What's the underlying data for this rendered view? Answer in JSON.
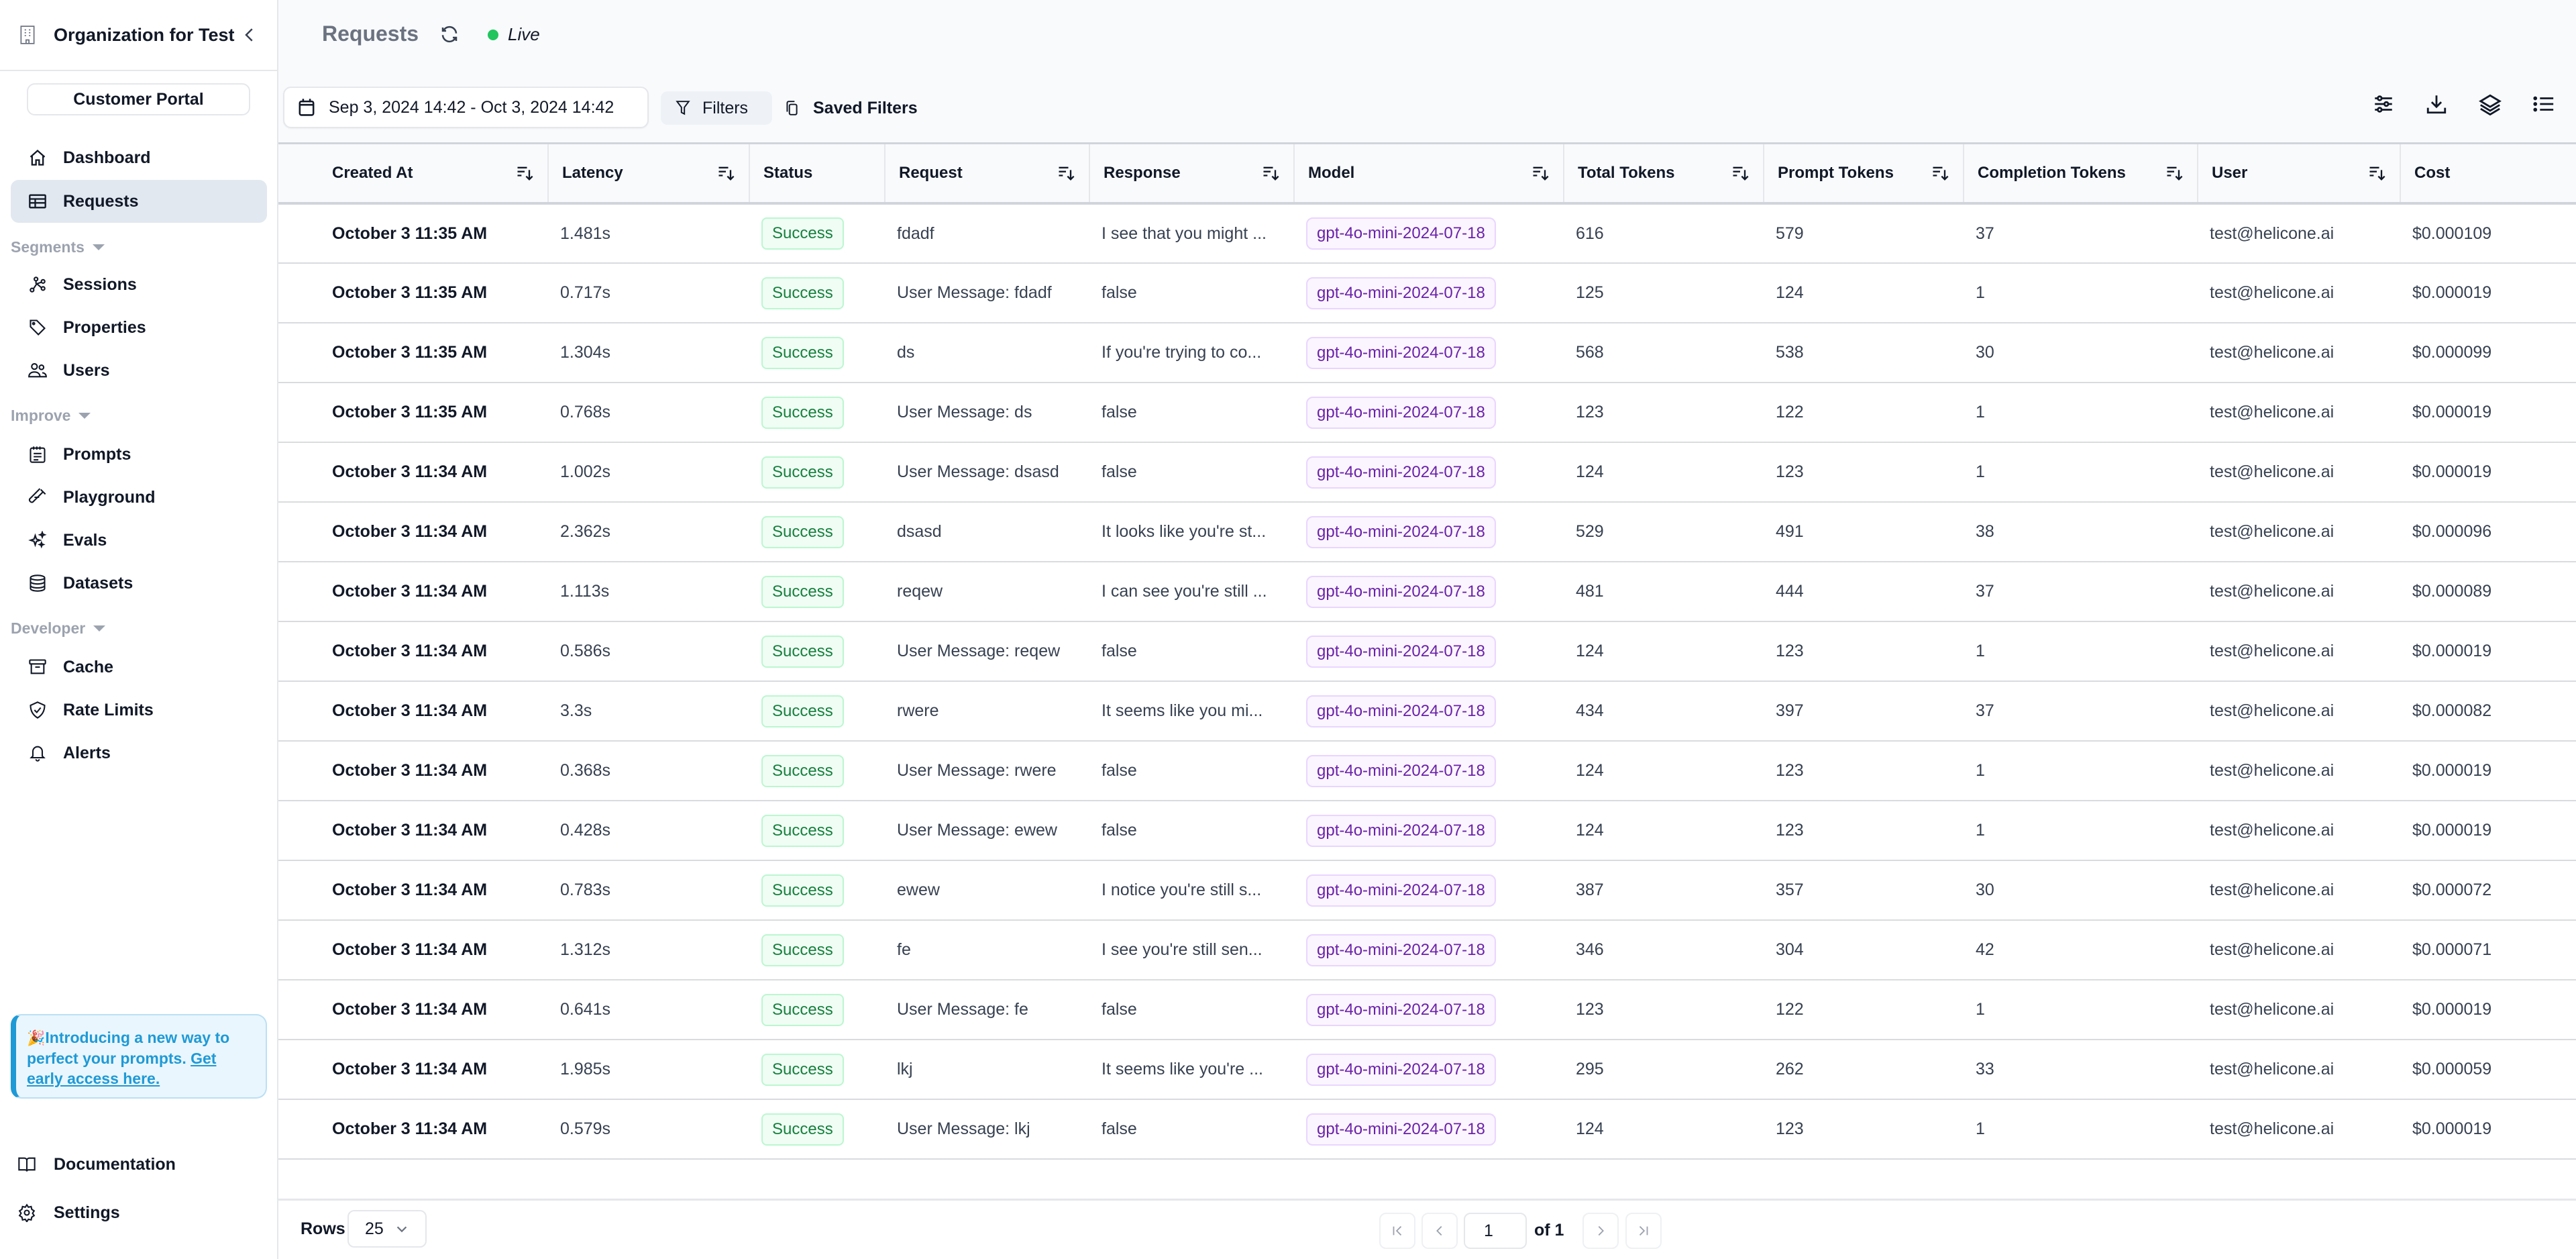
{
  "sidebar": {
    "org_name": "Organization for Test",
    "customer_portal": "Customer Portal",
    "top_items": [
      {
        "label": "Dashboard",
        "icon": "home-icon"
      },
      {
        "label": "Requests",
        "icon": "table-icon",
        "active": true
      }
    ],
    "sections": [
      {
        "label": "Segments",
        "items": [
          {
            "label": "Sessions",
            "icon": "sessions-icon"
          },
          {
            "label": "Properties",
            "icon": "tag-icon"
          },
          {
            "label": "Users",
            "icon": "users-icon"
          }
        ]
      },
      {
        "label": "Improve",
        "items": [
          {
            "label": "Prompts",
            "icon": "notepad-icon"
          },
          {
            "label": "Playground",
            "icon": "test-tube-icon"
          },
          {
            "label": "Evals",
            "icon": "sparkles-icon"
          },
          {
            "label": "Datasets",
            "icon": "database-icon"
          }
        ]
      },
      {
        "label": "Developer",
        "items": [
          {
            "label": "Cache",
            "icon": "archive-box-icon"
          },
          {
            "label": "Rate Limits",
            "icon": "shield-check-icon"
          },
          {
            "label": "Alerts",
            "icon": "bell-icon"
          }
        ]
      }
    ],
    "promo": {
      "emoji": "🎉",
      "text": "Introducing a new way to perfect your prompts. ",
      "link": "Get early access here."
    },
    "bottom_items": [
      {
        "label": "Documentation",
        "icon": "book-icon"
      },
      {
        "label": "Settings",
        "icon": "gear-icon"
      }
    ]
  },
  "header": {
    "title": "Requests",
    "live_label": "Live",
    "live_color": "#22c55e"
  },
  "toolbar": {
    "date_range": "Sep 3, 2024 14:42 - Oct 3, 2024 14:42",
    "filters_label": "Filters",
    "saved_filters_label": "Saved Filters",
    "right_icons": [
      "sliders-icon",
      "download-icon",
      "layers-icon",
      "list-icon"
    ]
  },
  "table": {
    "columns": [
      "Created At",
      "Latency",
      "Status",
      "Request",
      "Response",
      "Model",
      "Total Tokens",
      "Prompt Tokens",
      "Completion Tokens",
      "User",
      "Cost"
    ],
    "sortable": [
      true,
      true,
      false,
      true,
      true,
      true,
      true,
      true,
      true,
      true,
      false
    ],
    "rows": [
      {
        "created": "October 3 11:35 AM",
        "latency": "1.481s",
        "status": "Success",
        "request": "fdadf",
        "response": "I see that you might ...",
        "model": "gpt-4o-mini-2024-07-18",
        "total": "616",
        "prompt": "579",
        "completion": "37",
        "user": "test@helicone.ai",
        "cost": "$0.000109"
      },
      {
        "created": "October 3 11:35 AM",
        "latency": "0.717s",
        "status": "Success",
        "request": "User Message: fdadf",
        "response": "false",
        "model": "gpt-4o-mini-2024-07-18",
        "total": "125",
        "prompt": "124",
        "completion": "1",
        "user": "test@helicone.ai",
        "cost": "$0.000019"
      },
      {
        "created": "October 3 11:35 AM",
        "latency": "1.304s",
        "status": "Success",
        "request": "ds",
        "response": "If you're trying to co...",
        "model": "gpt-4o-mini-2024-07-18",
        "total": "568",
        "prompt": "538",
        "completion": "30",
        "user": "test@helicone.ai",
        "cost": "$0.000099"
      },
      {
        "created": "October 3 11:35 AM",
        "latency": "0.768s",
        "status": "Success",
        "request": "User Message: ds",
        "response": "false",
        "model": "gpt-4o-mini-2024-07-18",
        "total": "123",
        "prompt": "122",
        "completion": "1",
        "user": "test@helicone.ai",
        "cost": "$0.000019"
      },
      {
        "created": "October 3 11:34 AM",
        "latency": "1.002s",
        "status": "Success",
        "request": "User Message: dsasd",
        "response": "false",
        "model": "gpt-4o-mini-2024-07-18",
        "total": "124",
        "prompt": "123",
        "completion": "1",
        "user": "test@helicone.ai",
        "cost": "$0.000019"
      },
      {
        "created": "October 3 11:34 AM",
        "latency": "2.362s",
        "status": "Success",
        "request": "dsasd",
        "response": "It looks like you're st...",
        "model": "gpt-4o-mini-2024-07-18",
        "total": "529",
        "prompt": "491",
        "completion": "38",
        "user": "test@helicone.ai",
        "cost": "$0.000096"
      },
      {
        "created": "October 3 11:34 AM",
        "latency": "1.113s",
        "status": "Success",
        "request": "reqew",
        "response": "I can see you're still ...",
        "model": "gpt-4o-mini-2024-07-18",
        "total": "481",
        "prompt": "444",
        "completion": "37",
        "user": "test@helicone.ai",
        "cost": "$0.000089"
      },
      {
        "created": "October 3 11:34 AM",
        "latency": "0.586s",
        "status": "Success",
        "request": "User Message: reqew",
        "response": "false",
        "model": "gpt-4o-mini-2024-07-18",
        "total": "124",
        "prompt": "123",
        "completion": "1",
        "user": "test@helicone.ai",
        "cost": "$0.000019"
      },
      {
        "created": "October 3 11:34 AM",
        "latency": "3.3s",
        "status": "Success",
        "request": "rwere",
        "response": "It seems like you mi...",
        "model": "gpt-4o-mini-2024-07-18",
        "total": "434",
        "prompt": "397",
        "completion": "37",
        "user": "test@helicone.ai",
        "cost": "$0.000082"
      },
      {
        "created": "October 3 11:34 AM",
        "latency": "0.368s",
        "status": "Success",
        "request": "User Message: rwere",
        "response": "false",
        "model": "gpt-4o-mini-2024-07-18",
        "total": "124",
        "prompt": "123",
        "completion": "1",
        "user": "test@helicone.ai",
        "cost": "$0.000019"
      },
      {
        "created": "October 3 11:34 AM",
        "latency": "0.428s",
        "status": "Success",
        "request": "User Message: ewew",
        "response": "false",
        "model": "gpt-4o-mini-2024-07-18",
        "total": "124",
        "prompt": "123",
        "completion": "1",
        "user": "test@helicone.ai",
        "cost": "$0.000019"
      },
      {
        "created": "October 3 11:34 AM",
        "latency": "0.783s",
        "status": "Success",
        "request": "ewew",
        "response": "I notice you're still s...",
        "model": "gpt-4o-mini-2024-07-18",
        "total": "387",
        "prompt": "357",
        "completion": "30",
        "user": "test@helicone.ai",
        "cost": "$0.000072"
      },
      {
        "created": "October 3 11:34 AM",
        "latency": "1.312s",
        "status": "Success",
        "request": "fe",
        "response": "I see you're still sen...",
        "model": "gpt-4o-mini-2024-07-18",
        "total": "346",
        "prompt": "304",
        "completion": "42",
        "user": "test@helicone.ai",
        "cost": "$0.000071"
      },
      {
        "created": "October 3 11:34 AM",
        "latency": "0.641s",
        "status": "Success",
        "request": "User Message: fe",
        "response": "false",
        "model": "gpt-4o-mini-2024-07-18",
        "total": "123",
        "prompt": "122",
        "completion": "1",
        "user": "test@helicone.ai",
        "cost": "$0.000019"
      },
      {
        "created": "October 3 11:34 AM",
        "latency": "1.985s",
        "status": "Success",
        "request": "lkj",
        "response": "It seems like you're ...",
        "model": "gpt-4o-mini-2024-07-18",
        "total": "295",
        "prompt": "262",
        "completion": "33",
        "user": "test@helicone.ai",
        "cost": "$0.000059"
      },
      {
        "created": "October 3 11:34 AM",
        "latency": "0.579s",
        "status": "Success",
        "request": "User Message: lkj",
        "response": "false",
        "model": "gpt-4o-mini-2024-07-18",
        "total": "124",
        "prompt": "123",
        "completion": "1",
        "user": "test@helicone.ai",
        "cost": "$0.000019"
      }
    ]
  },
  "footer": {
    "rows_label": "Rows",
    "rows_per_page": "25",
    "page_value": "1",
    "page_of": "of 1"
  },
  "colors": {
    "success_text": "#15803d",
    "success_bg": "#f0fdf4",
    "model_text": "#6b21a8",
    "model_bg": "#faf5ff",
    "promo_accent": "#1e9ad6",
    "active_nav_bg": "#e2e8f0"
  }
}
